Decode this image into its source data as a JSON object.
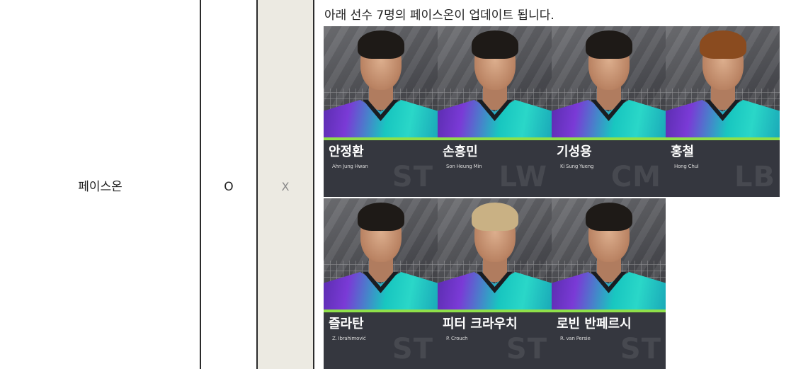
{
  "row": {
    "label": "페이스온",
    "col_o": "O",
    "col_x": "X",
    "notice": "아래 선수 7명의 페이스온이 업데이트 됩니다."
  },
  "players": [
    {
      "korean_name": "안정환",
      "english_name": "Ahn Jung Hwan",
      "position": "ST"
    },
    {
      "korean_name": "손흥민",
      "english_name": "Son Heung Min",
      "position": "LW"
    },
    {
      "korean_name": "기성용",
      "english_name": "Ki Sung Yueng",
      "position": "CM"
    },
    {
      "korean_name": "홍철",
      "english_name": "Hong Chul",
      "position": "LB"
    },
    {
      "korean_name": "즐라탄",
      "english_name": "Z. Ibrahimović",
      "position": "ST"
    },
    {
      "korean_name": "피터 크라우치",
      "english_name": "P. Crouch",
      "position": "ST"
    },
    {
      "korean_name": "로빈 반페르시",
      "english_name": "R. van Persie",
      "position": "ST"
    }
  ],
  "colors": {
    "x_column_bg": "#eceae2",
    "card_plate": "#35373f",
    "jersey_accent": "#8fe04a"
  }
}
